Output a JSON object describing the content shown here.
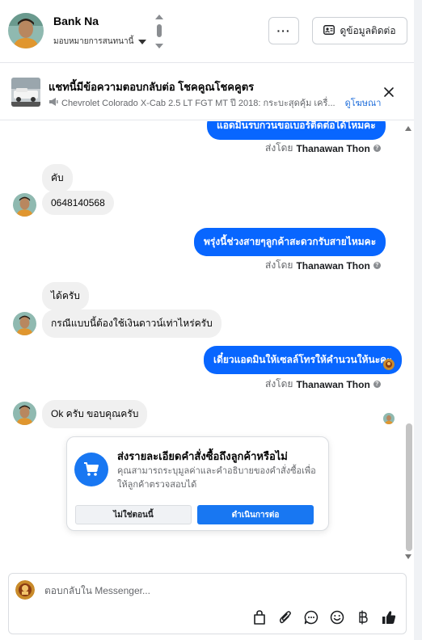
{
  "header": {
    "contact_name": "Bank Na",
    "assign_label": "มอบหมายการสนทนานี้",
    "more_label": "···",
    "view_info_label": "ดูข้อมูลติดต่อ"
  },
  "ad_banner": {
    "title": "แชทนี้มีข้อความตอบกลับต่อ โชคคูณโชคคูตร",
    "subtitle": "Chevrolet Colorado X-Cab 2.5 LT FGT MT ปี 2018: กระบะสุดคุ้ม เครื่...",
    "link": "ดูโฆษณา"
  },
  "messages": [
    {
      "direction": "out",
      "text": "แอดมินรบกวนขอเบอร์ติดต่อได้ไหมคะ"
    },
    {
      "type": "sent_by",
      "prefix": "ส่งโดย",
      "name": "Thanawan Thon"
    },
    {
      "direction": "in",
      "text": "คับ"
    },
    {
      "direction": "in",
      "text": "0648140568"
    },
    {
      "direction": "out",
      "text": "พรุ่งนี้ช่วงสายๆลูกค้าสะดวกรับสายไหมคะ"
    },
    {
      "type": "sent_by",
      "prefix": "ส่งโดย",
      "name": "Thanawan Thon"
    },
    {
      "direction": "in",
      "text": "ได้ครับ"
    },
    {
      "direction": "in",
      "text": "กรณีแบบนี้ต้องใช้เงินดาวน์เท่าไหร่ครับ"
    },
    {
      "direction": "out",
      "text": "เดี๋ยวแอดมินให้เซลล์โทรให้คำนวนให้นะคะ"
    },
    {
      "type": "sent_by",
      "prefix": "ส่งโดย",
      "name": "Thanawan Thon"
    },
    {
      "direction": "in",
      "text": "Ok ครับ ขอบคุณครับ"
    }
  ],
  "order_card": {
    "title": "ส่งรายละเอียดคำสั่งซื้อถึงลูกค้าหรือไม่",
    "description": "คุณสามารถระบุมูลค่าและคำอธิบายของคำสั่งซื้อเพื่อให้ลูกค้าตรวจสอบได้",
    "decline_label": "ไม่ใช่ตอนนี้",
    "accept_label": "ดำเนินการต่อ",
    "icon": "cart-icon"
  },
  "composer": {
    "placeholder": "ตอบกลับใน Messenger...",
    "tools": [
      "bag-icon",
      "paperclip-icon",
      "saved-reply-icon",
      "emoji-icon",
      "baht-icon",
      "thumbs-up-icon"
    ]
  },
  "colors": {
    "brand_blue": "#0866ff",
    "incoming_bubble": "#f0f0f0",
    "card_button_blue": "#1877f2"
  }
}
